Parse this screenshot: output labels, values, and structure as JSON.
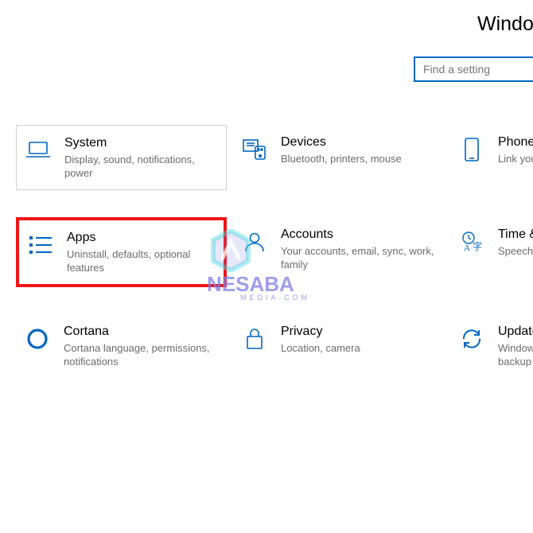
{
  "header": {
    "title": "Windows Settings"
  },
  "search": {
    "placeholder": "Find a setting",
    "value": ""
  },
  "tiles": {
    "system": {
      "title": "System",
      "desc": "Display, sound, notifications, power"
    },
    "devices": {
      "title": "Devices",
      "desc": "Bluetooth, printers, mouse"
    },
    "phone": {
      "title": "Phone",
      "desc": "Link your Android, iPhone"
    },
    "apps": {
      "title": "Apps",
      "desc": "Uninstall, defaults, optional features"
    },
    "accounts": {
      "title": "Accounts",
      "desc": "Your accounts, email, sync, work, family"
    },
    "time": {
      "title": "Time & Language",
      "desc": "Speech, region, date"
    },
    "cortana": {
      "title": "Cortana",
      "desc": "Cortana language, permissions, notifications"
    },
    "privacy": {
      "title": "Privacy",
      "desc": "Location, camera"
    },
    "update": {
      "title": "Update & Security",
      "desc": "Windows Update, recovery, backup"
    }
  },
  "highlight": "apps",
  "watermark": {
    "name": "NESABA",
    "sub": "MEDIA.COM"
  }
}
